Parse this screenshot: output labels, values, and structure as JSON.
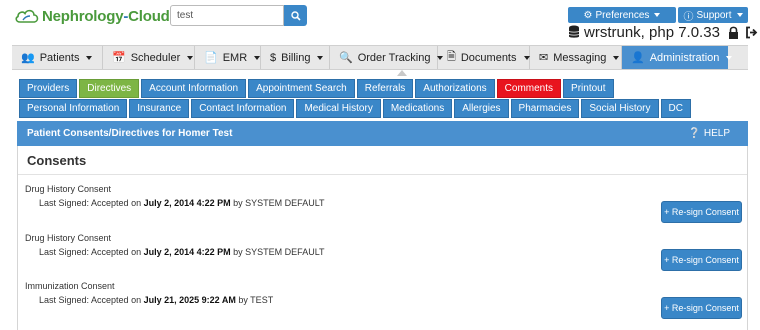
{
  "brand": {
    "name_part1": "Nephrology",
    "name_dash": "-",
    "name_part2": "Cloud",
    "green": "#4a9a3c",
    "blue": "#2b77b6"
  },
  "search": {
    "value": "test",
    "icon": "search-icon"
  },
  "top_right": {
    "preferences_label": "Preferences",
    "support_label": "Support",
    "user_text": "wrstrunk, php 7.0.33"
  },
  "nav": {
    "items": [
      {
        "label": "Patients",
        "icon": "users-icon"
      },
      {
        "label": "Scheduler",
        "icon": "calendar-icon"
      },
      {
        "label": "EMR",
        "icon": "document-icon"
      },
      {
        "label": "Billing",
        "icon": "dollar-icon"
      },
      {
        "label": "Order Tracking",
        "icon": "search-icon"
      },
      {
        "label": "Documents",
        "icon": "file-icon"
      },
      {
        "label": "Messaging",
        "icon": "envelope-icon"
      },
      {
        "label": "Administration",
        "icon": "user-icon"
      }
    ]
  },
  "tabs_row1": [
    "Providers",
    "Directives",
    "Account Information",
    "Appointment Search",
    "Referrals",
    "Authorizations",
    "Comments",
    "Printout"
  ],
  "tabs_row2": [
    "Personal Information",
    "Insurance",
    "Contact Information",
    "Medical History",
    "Medications",
    "Allergies",
    "Pharmacies",
    "Social History",
    "DC"
  ],
  "panel": {
    "title": "Patient Consents/Directives for Homer Test",
    "help_label": "HELP"
  },
  "consents": {
    "heading": "Consents",
    "items": [
      {
        "name": "Drug History Consent",
        "prefix": "Last Signed: Accepted on",
        "date": "July 2, 2014 4:22 PM",
        "by": "by SYSTEM DEFAULT",
        "button": "+ Re-sign Consent"
      },
      {
        "name": "Drug History Consent",
        "prefix": "Last Signed: Accepted on",
        "date": "July 2, 2014 4:22 PM",
        "by": "by SYSTEM DEFAULT",
        "button": "+ Re-sign Consent"
      },
      {
        "name": "Immunization Consent",
        "prefix": "Last Signed: Accepted on",
        "date": "July 21, 2025 9:22 AM",
        "by": "by TEST",
        "button": "+ Re-sign Consent"
      }
    ]
  },
  "colors": {
    "primary": "#3a87c8",
    "active_nav": "#4a90cf",
    "directives_tab": "#7db545",
    "comments_tab": "#e8141e"
  }
}
